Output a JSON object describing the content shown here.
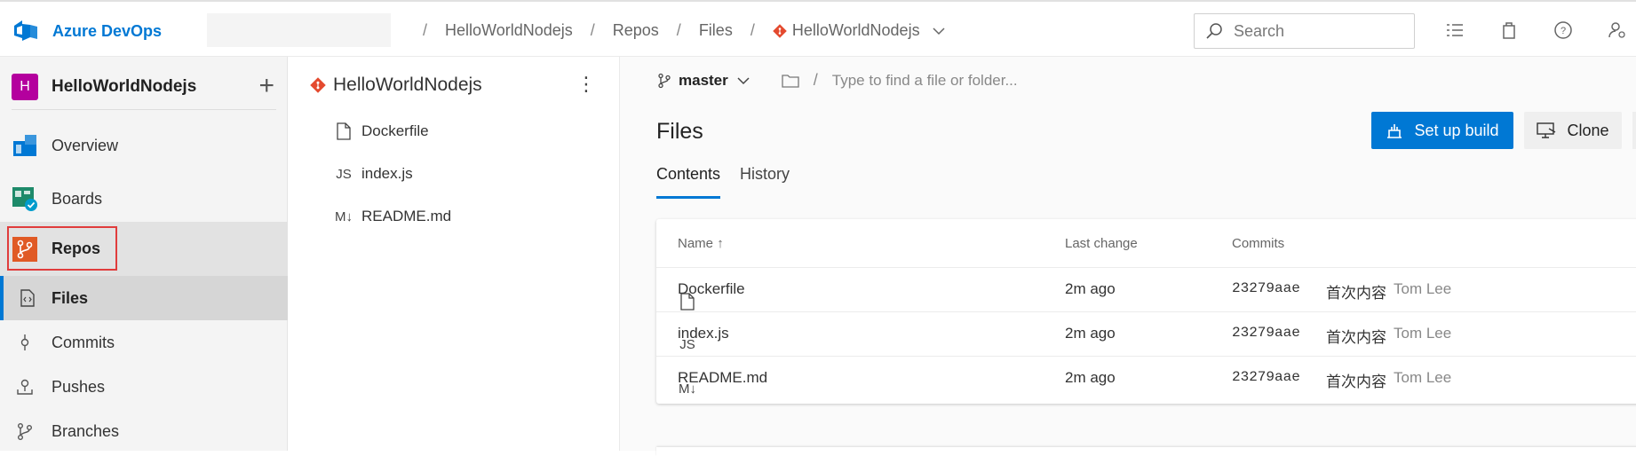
{
  "header": {
    "brand": "Azure DevOps",
    "breadcrumbs": [
      "HelloWorldNodejs",
      "Repos",
      "Files",
      "HelloWorldNodejs"
    ],
    "search_placeholder": "Search"
  },
  "sidebar": {
    "project_initial": "H",
    "project_name": "HelloWorldNodejs",
    "items": [
      {
        "label": "Overview"
      },
      {
        "label": "Boards"
      },
      {
        "label": "Repos"
      },
      {
        "label": "Files"
      },
      {
        "label": "Commits"
      },
      {
        "label": "Pushes"
      },
      {
        "label": "Branches"
      }
    ],
    "accent": "#0078d4"
  },
  "tree": {
    "repo_name": "HelloWorldNodejs",
    "files": [
      {
        "icon": "file-icon",
        "name": "Dockerfile"
      },
      {
        "icon": "js-file-icon",
        "badge": "JS",
        "name": "index.js"
      },
      {
        "icon": "markdown-file-icon",
        "badge": "M↓",
        "name": "README.md"
      }
    ]
  },
  "main": {
    "branch": "master",
    "path_placeholder": "Type to find a file or folder...",
    "title": "Files",
    "setup_build_label": "Set up build",
    "clone_label": "Clone",
    "tabs": [
      "Contents",
      "History"
    ],
    "columns": {
      "name": "Name",
      "sort_arrow": "↑",
      "last_change": "Last change",
      "commits": "Commits"
    },
    "rows": [
      {
        "name": "Dockerfile",
        "badge": "",
        "last_change": "2m ago",
        "commit": "23279aae",
        "message": "首次内容",
        "author": "Tom Lee"
      },
      {
        "name": "index.js",
        "badge": "JS",
        "last_change": "2m ago",
        "commit": "23279aae",
        "message": "首次内容",
        "author": "Tom Lee"
      },
      {
        "name": "README.md",
        "badge": "M↓",
        "last_change": "2m ago",
        "commit": "23279aae",
        "message": "首次内容",
        "author": "Tom Lee"
      }
    ]
  }
}
